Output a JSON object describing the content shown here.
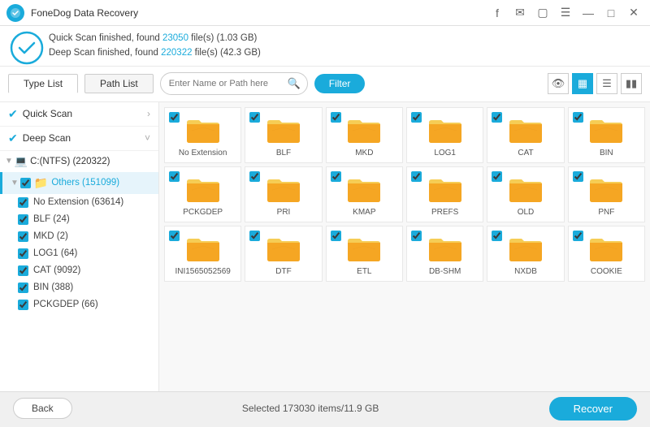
{
  "titlebar": {
    "title": "FoneDog Data Recovery",
    "icons": [
      "facebook",
      "message",
      "save",
      "menu",
      "minimize",
      "maximize",
      "close"
    ]
  },
  "statusbar": {
    "line1_prefix": "Quick Scan finished, found ",
    "line1_files": "23050",
    "line1_suffix": " file(s) (1.03 GB)",
    "line2_prefix": "Deep Scan finished, found ",
    "line2_files": "220322",
    "line2_suffix": " file(s) (42.3 GB)"
  },
  "toolbar": {
    "tab_type": "Type List",
    "tab_path": "Path List",
    "search_placeholder": "Enter Name or Path here",
    "filter_label": "Filter",
    "view_icons": [
      "eye",
      "grid",
      "list",
      "columns"
    ]
  },
  "sidebar": {
    "scan_items": [
      {
        "label": "Quick Scan",
        "arrow": "›"
      },
      {
        "label": "Deep Scan",
        "arrow": "˅"
      }
    ],
    "drive": "C:(NTFS) (220322)",
    "folder": "Others (151099)",
    "files": [
      {
        "label": "No Extension (63614)",
        "checked": true
      },
      {
        "label": "BLF (24)",
        "checked": true
      },
      {
        "label": "MKD (2)",
        "checked": true
      },
      {
        "label": "LOG1 (64)",
        "checked": true
      },
      {
        "label": "CAT (9092)",
        "checked": true
      },
      {
        "label": "BIN (388)",
        "checked": true
      },
      {
        "label": "PCKGDEP (66)",
        "checked": true
      }
    ]
  },
  "grid_items": [
    {
      "label": "No Extension",
      "checked": true
    },
    {
      "label": "BLF",
      "checked": true
    },
    {
      "label": "MKD",
      "checked": true
    },
    {
      "label": "LOG1",
      "checked": true
    },
    {
      "label": "CAT",
      "checked": true
    },
    {
      "label": "BIN",
      "checked": true
    },
    {
      "label": "PCKGDEP",
      "checked": true
    },
    {
      "label": "PRI",
      "checked": true
    },
    {
      "label": "KMAP",
      "checked": true
    },
    {
      "label": "PREFS",
      "checked": true
    },
    {
      "label": "OLD",
      "checked": true
    },
    {
      "label": "PNF",
      "checked": true
    },
    {
      "label": "INI1565052569",
      "checked": true
    },
    {
      "label": "DTF",
      "checked": true
    },
    {
      "label": "ETL",
      "checked": true
    },
    {
      "label": "DB-SHM",
      "checked": true
    },
    {
      "label": "NXDB",
      "checked": true
    },
    {
      "label": "COOKIE",
      "checked": true
    }
  ],
  "bottombar": {
    "back_label": "Back",
    "status_text": "Selected 173030 items/11.9 GB",
    "recover_label": "Recover"
  }
}
